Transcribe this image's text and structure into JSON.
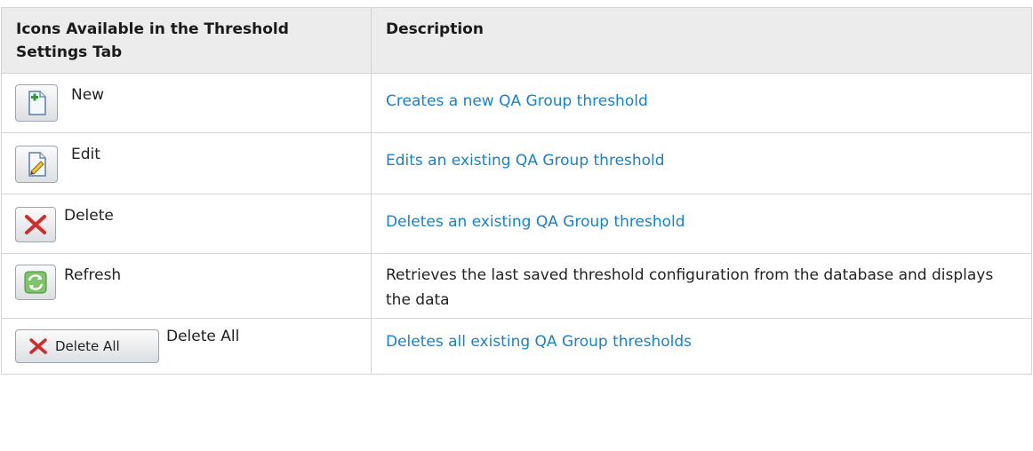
{
  "table": {
    "headers": {
      "icons": "Icons Available in the Threshold Settings Tab",
      "description": "Description"
    },
    "rows": [
      {
        "icon": "new-document-icon",
        "label": "New",
        "description": "Creates a new QA Group threshold",
        "description_is_link": true
      },
      {
        "icon": "edit-pencil-icon",
        "label": "Edit",
        "description": "Edits an existing QA Group threshold",
        "description_is_link": true
      },
      {
        "icon": "delete-x-icon",
        "label": "Delete",
        "description": "Deletes an existing QA Group threshold",
        "description_is_link": true
      },
      {
        "icon": "refresh-icon",
        "label": "Refresh",
        "description": "Retrieves the last saved threshold configuration from the database and displays the data",
        "description_is_link": false
      },
      {
        "icon": "delete-all-icon",
        "button_text": "Delete All",
        "label": "Delete All",
        "description": "Deletes all existing QA Group thresholds",
        "description_is_link": true
      }
    ]
  },
  "colors": {
    "link": "#1a82c6",
    "header_bg": "#ececec",
    "border": "#d4d4d4"
  }
}
